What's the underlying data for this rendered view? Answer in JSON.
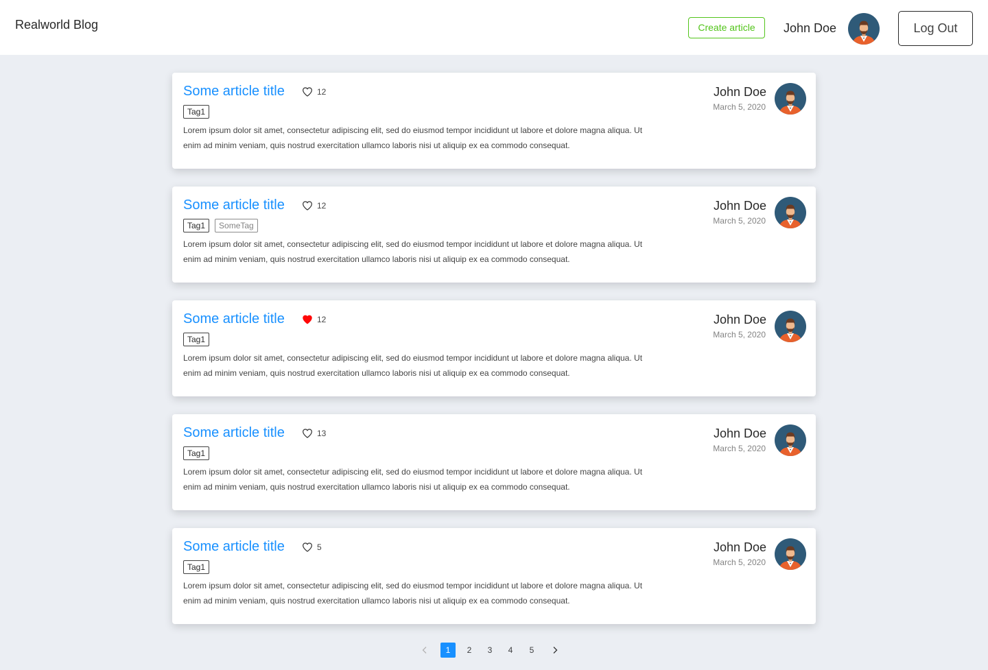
{
  "header": {
    "brand": "Realworld Blog",
    "create_label": "Create article",
    "username": "John Doe",
    "logout_label": "Log Out"
  },
  "articles": [
    {
      "title": "Some article title",
      "likes": "12",
      "liked": false,
      "tags": [
        "Tag1"
      ],
      "description": "Lorem ipsum dolor sit amet, consectetur adipiscing elit, sed do eiusmod tempor incididunt ut labore et dolore magna aliqua. Ut enim ad minim veniam, quis nostrud exercitation ullamco laboris  nisi ut aliquip ex ea commodo consequat.",
      "author": "John Doe",
      "date": "March 5, 2020"
    },
    {
      "title": "Some article title",
      "likes": "12",
      "liked": false,
      "tags": [
        "Tag1",
        "SomeTag"
      ],
      "description": "Lorem ipsum dolor sit amet, consectetur adipiscing elit, sed do eiusmod tempor incididunt ut labore et dolore magna aliqua. Ut enim ad minim veniam, quis nostrud exercitation ullamco laboris  nisi ut aliquip ex ea commodo consequat.",
      "author": "John Doe",
      "date": "March 5, 2020"
    },
    {
      "title": "Some article title",
      "likes": "12",
      "liked": true,
      "tags": [
        "Tag1"
      ],
      "description": "Lorem ipsum dolor sit amet, consectetur adipiscing elit, sed do eiusmod tempor incididunt ut labore et dolore magna aliqua. Ut enim ad minim veniam, quis nostrud exercitation ullamco laboris  nisi ut aliquip ex ea commodo consequat.",
      "author": "John Doe",
      "date": "March 5, 2020"
    },
    {
      "title": "Some article title",
      "likes": "13",
      "liked": false,
      "tags": [
        "Tag1"
      ],
      "description": "Lorem ipsum dolor sit amet, consectetur adipiscing elit, sed do eiusmod tempor incididunt ut labore et dolore magna aliqua. Ut enim ad minim veniam, quis nostrud exercitation ullamco laboris  nisi ut aliquip ex ea commodo consequat.",
      "author": "John Doe",
      "date": "March 5, 2020"
    },
    {
      "title": "Some article title",
      "likes": "5",
      "liked": false,
      "tags": [
        "Tag1"
      ],
      "description": "Lorem ipsum dolor sit amet, consectetur adipiscing elit, sed do eiusmod tempor incididunt ut labore et dolore magna aliqua. Ut enim ad minim veniam, quis nostrud exercitation ullamco laboris  nisi ut aliquip ex ea commodo consequat.",
      "author": "John Doe",
      "date": "March 5, 2020"
    }
  ],
  "pagination": {
    "pages": [
      "1",
      "2",
      "3",
      "4",
      "5"
    ],
    "current": "1"
  },
  "icons": {
    "like": "heart-outline-icon",
    "liked": "heart-filled-icon",
    "prev": "chevron-left-icon",
    "next": "chevron-right-icon",
    "avatar": "avatar-icon"
  },
  "colors": {
    "accent": "#1890ff",
    "create": "#52c41a",
    "liked": "#ff0707",
    "background": "#ebeef3"
  }
}
